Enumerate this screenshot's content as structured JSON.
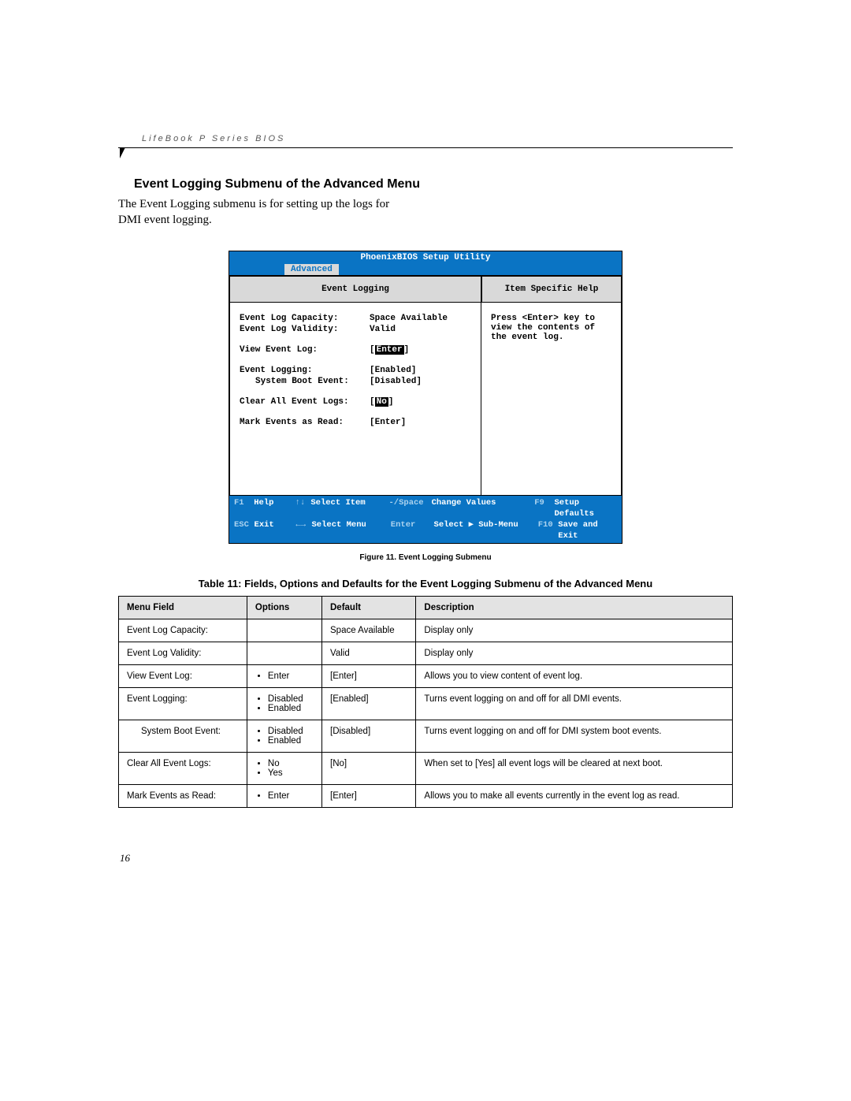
{
  "header": {
    "running_head": "LifeBook P Series BIOS"
  },
  "section": {
    "title": "Event Logging Submenu of the Advanced Menu",
    "intro_line1": "The Event Logging submenu is for setting up the logs  for",
    "intro_line2": "DMI event logging."
  },
  "bios": {
    "title": "PhoenixBIOS Setup Utility",
    "tab": "Advanced",
    "left_header": "Event Logging",
    "right_header": "Item Specific Help",
    "rows": {
      "capacity_label": "Event Log Capacity:",
      "capacity_value": "Space Available",
      "validity_label": "Event Log Validity:",
      "validity_value": "Valid",
      "view_label": "View Event Log:",
      "view_value": "Enter",
      "logging_label": "Event Logging:",
      "logging_value": "[Enabled]",
      "sysboot_label": "System Boot Event:",
      "sysboot_value": "[Disabled]",
      "clear_label": "Clear All Event Logs:",
      "clear_value": "No",
      "mark_label": "Mark Events as Read:",
      "mark_value": "[Enter]"
    },
    "help": {
      "l1": "Press <Enter> key to",
      "l2": "view the contents of",
      "l3": "the event log."
    },
    "footer": {
      "f1": "F1",
      "help": "Help",
      "up": "↑↓",
      "select_item": "Select Item",
      "minus": "-/Space",
      "change": "Change Values",
      "f9": "F9",
      "defaults": "Setup Defaults",
      "esc": "ESC",
      "exit": "Exit",
      "lr": "←→",
      "select_menu": "Select Menu",
      "enter": "Enter",
      "submenu": "Select ▶ Sub-Menu",
      "f10": "F10",
      "save": "Save and Exit"
    }
  },
  "figure_caption": "Figure 11.  Event Logging Submenu",
  "table_caption": "Table 11: Fields, Options and Defaults for the Event Logging Submenu of the Advanced Menu",
  "table": {
    "headers": {
      "c1": "Menu Field",
      "c2": "Options",
      "c3": "Default",
      "c4": "Description"
    },
    "r1": {
      "field": "Event Log Capacity:",
      "opt": "",
      "def": "Space Available",
      "desc": "Display only"
    },
    "r2": {
      "field": "Event Log Validity:",
      "opt": "",
      "def": "Valid",
      "desc": "Display only"
    },
    "r3": {
      "field": "View Event Log:",
      "opt1": "Enter",
      "def": "[Enter]",
      "desc": "Allows you to view content of event log."
    },
    "r4": {
      "field": "Event Logging:",
      "opt1": "Disabled",
      "opt2": "Enabled",
      "def": "[Enabled]",
      "desc": "Turns event logging on and off for all DMI events."
    },
    "r5": {
      "field": "System Boot Event:",
      "opt1": "Disabled",
      "opt2": "Enabled",
      "def": "[Disabled]",
      "desc": "Turns event logging on and off for DMI system boot events."
    },
    "r6": {
      "field": "Clear All Event Logs:",
      "opt1": "No",
      "opt2": "Yes",
      "def": "[No]",
      "desc": "When set to [Yes] all event logs will be cleared at next boot."
    },
    "r7": {
      "field": "Mark Events as Read:",
      "opt1": "Enter",
      "def": "[Enter]",
      "desc": "Allows you to make all events currently in the event log as read."
    }
  },
  "page_number": "16"
}
